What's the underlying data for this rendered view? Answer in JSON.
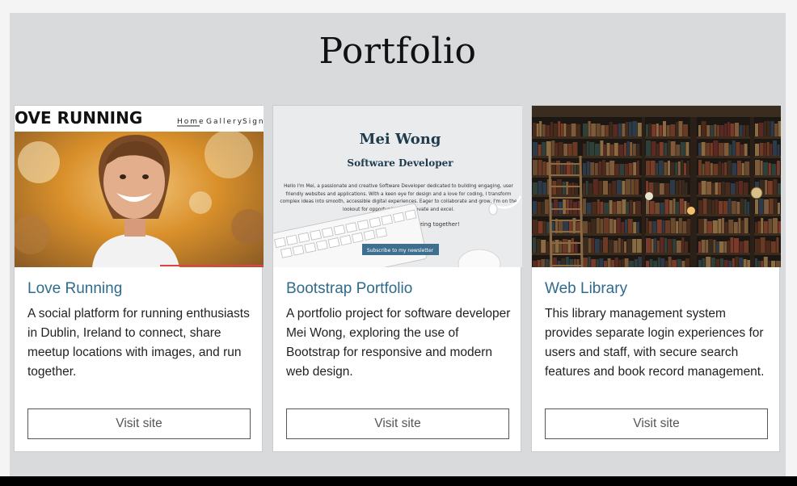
{
  "page": {
    "title": "Portfolio"
  },
  "colors": {
    "section_bg": "#d8dadc",
    "title_link": "#2f6b8c",
    "card_bg": "#ffffff"
  },
  "cards": [
    {
      "title": "Love Running",
      "description": "A social platform for running enthusiasts in Dublin, Ireland to connect, share meetup locations with images, and run together.",
      "button": "Visit site",
      "thumb": {
        "brand": "OVE RUNNING",
        "nav": [
          "Home",
          "Gallery",
          "Sign"
        ]
      }
    },
    {
      "title": "Bootstrap Portfolio",
      "description": "A portfolio project for software developer Mei Wong, exploring the use of Bootstrap for responsive and modern web design.",
      "button": "Visit site",
      "thumb": {
        "name": "Mei Wong",
        "role": "Software Developer",
        "intro": "Hello I'm Mei, a passionate and creative Software Developer dedicated to building engaging, user friendly websites and applications. With a keen eye for design and a love for coding, I transform complex ideas into smooth, accessible digital experiences. Eager to collaborate and grow, I'm on the lookout for opportunities to innovate and excel.",
        "cta": "Let's create something amazing together!",
        "button": "Subscribe to my newsletter"
      }
    },
    {
      "title": "Web Library",
      "description": "This library management system provides separate login experiences for users and staff, with secure search features and book record management.",
      "button": "Visit site"
    }
  ]
}
